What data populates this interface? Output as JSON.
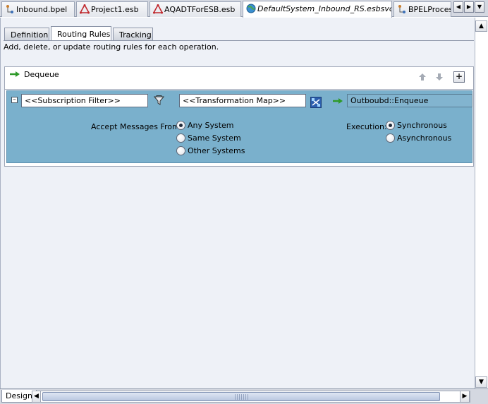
{
  "editor_tabs": [
    {
      "label": "Inbound.bpel",
      "icon": "bpel-process-icon"
    },
    {
      "label": "Project1.esb",
      "icon": "esb-project-icon"
    },
    {
      "label": "AQADTForESB.esb",
      "icon": "esb-project-icon"
    },
    {
      "label": "DefaultSystem_Inbound_RS.esbsvc",
      "icon": "globe-icon"
    },
    {
      "label": "BPELProcess",
      "icon": "bpel-process-icon"
    }
  ],
  "sub_tabs": [
    {
      "label": "Definition"
    },
    {
      "label": "Routing Rules"
    },
    {
      "label": "Tracking"
    }
  ],
  "description": "Add, delete, or update routing rules for each operation.",
  "operation": {
    "name": "Dequeue",
    "icon": "operation-arrow-icon"
  },
  "rule": {
    "subscription_filter": "<<Subscription Filter>>",
    "transformation_map": "<<Transformation Map>>",
    "target": "Outboubd::Enqueue",
    "accept_label": "Accept Messages From:",
    "accept_options": [
      {
        "label": "Any System",
        "selected": true
      },
      {
        "label": "Same System",
        "selected": false
      },
      {
        "label": "Other Systems",
        "selected": false
      }
    ],
    "execution_label": "Execution:",
    "execution_options": [
      {
        "label": "Synchronous",
        "selected": true
      },
      {
        "label": "Asynchronous",
        "selected": false
      }
    ]
  },
  "bottom": {
    "design_tab": "Design"
  },
  "colors": {
    "rule_background": "#7ab0cc",
    "arrow_green": "#2f9a2a"
  }
}
